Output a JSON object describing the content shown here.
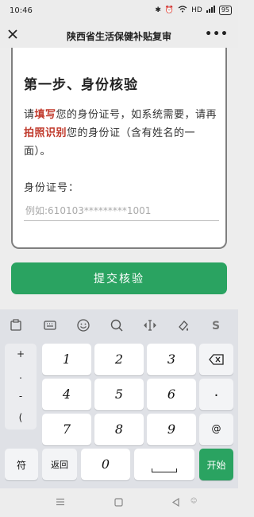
{
  "status": {
    "time": "10:46",
    "network": "HD",
    "battery": "95"
  },
  "header": {
    "title": "陕西省生活保健补贴复审",
    "more": "•••"
  },
  "card": {
    "step_title": "第一步、身份核验",
    "instr_1": "请",
    "instr_2": "填写",
    "instr_3": "您的身份证号，如系统需要，请再",
    "instr_4": "拍照识别",
    "instr_5": "您的身份证（含有姓名的一面）。",
    "id_label": "身份证号：",
    "id_placeholder": "例如:610103*********1001"
  },
  "submit_label": "提交核验",
  "keyboard": {
    "side": [
      "+",
      ".",
      "-",
      "("
    ],
    "keys": [
      "1",
      "2",
      "3",
      "4",
      "5",
      "6",
      "7",
      "8",
      "9",
      "0",
      "@"
    ],
    "symbol": "符",
    "back": "返回",
    "start": "开始"
  },
  "colors": {
    "accent": "#2aa361",
    "highlight": "#c0392b"
  }
}
